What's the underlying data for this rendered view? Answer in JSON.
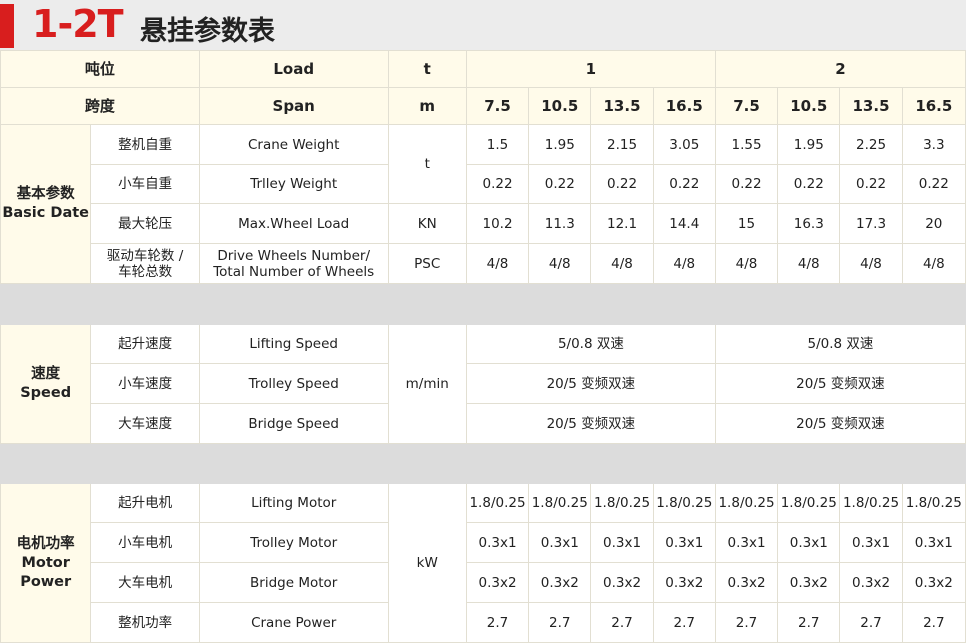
{
  "title": {
    "num": "1-2T",
    "text": "悬挂参数表"
  },
  "header": {
    "row1": {
      "cn": "吨位",
      "en": "Load",
      "unit": "t",
      "cap1": "1",
      "cap2": "2"
    },
    "row2": {
      "cn": "跨度",
      "en": "Span",
      "unit": "m",
      "spans": [
        "7.5",
        "10.5",
        "13.5",
        "16.5",
        "7.5",
        "10.5",
        "13.5",
        "16.5"
      ]
    }
  },
  "groups": {
    "basic": {
      "cn": "基本参数",
      "en": "Basic Date"
    },
    "speed": {
      "cn": "速度",
      "en": "Speed"
    },
    "motor": {
      "cn": "电机功率",
      "en1": "Motor",
      "en2": "Power"
    }
  },
  "units": {
    "weight": "t",
    "wheel_load": "KN",
    "wheels": "PSC",
    "speed": "m/min",
    "power": "kW"
  },
  "rows": {
    "crane_weight": {
      "cn": "整机自重",
      "en": "Crane Weight",
      "values": [
        "1.5",
        "1.95",
        "2.15",
        "3.05",
        "1.55",
        "1.95",
        "2.25",
        "3.3"
      ]
    },
    "trolley_weight": {
      "cn": "小车自重",
      "en": "Trlley Weight",
      "values": [
        "0.22",
        "0.22",
        "0.22",
        "0.22",
        "0.22",
        "0.22",
        "0.22",
        "0.22"
      ]
    },
    "wheel_load": {
      "cn": "最大轮压",
      "en": "Max.Wheel Load",
      "values": [
        "10.2",
        "11.3",
        "12.1",
        "14.4",
        "15",
        "16.3",
        "17.3",
        "20"
      ]
    },
    "wheels": {
      "cn1": "驱动车轮数 /",
      "cn2": "车轮总数",
      "en1": "Drive Wheels Number/",
      "en2": "Total Number of Wheels",
      "values": [
        "4/8",
        "4/8",
        "4/8",
        "4/8",
        "4/8",
        "4/8",
        "4/8",
        "4/8"
      ]
    },
    "lifting_speed": {
      "cn": "起升速度",
      "en": "Lifting Speed",
      "v1": "5/0.8 双速",
      "v2": "5/0.8 双速"
    },
    "trolley_speed": {
      "cn": "小车速度",
      "en": "Trolley Speed",
      "v1": "20/5 变频双速",
      "v2": "20/5 变频双速"
    },
    "bridge_speed": {
      "cn": "大车速度",
      "en": "Bridge Speed",
      "v1": "20/5 变频双速",
      "v2": "20/5 变频双速"
    },
    "lifting_motor": {
      "cn": "起升电机",
      "en": "Lifting Motor",
      "values": [
        "1.8/0.25",
        "1.8/0.25",
        "1.8/0.25",
        "1.8/0.25",
        "1.8/0.25",
        "1.8/0.25",
        "1.8/0.25",
        "1.8/0.25"
      ]
    },
    "trolley_motor": {
      "cn": "小车电机",
      "en": "Trolley Motor",
      "values": [
        "0.3x1",
        "0.3x1",
        "0.3x1",
        "0.3x1",
        "0.3x1",
        "0.3x1",
        "0.3x1",
        "0.3x1"
      ]
    },
    "bridge_motor": {
      "cn": "大车电机",
      "en": "Bridge Motor",
      "values": [
        "0.3x2",
        "0.3x2",
        "0.3x2",
        "0.3x2",
        "0.3x2",
        "0.3x2",
        "0.3x2",
        "0.3x2"
      ]
    },
    "crane_power": {
      "cn": "整机功率",
      "en": "Crane Power",
      "values": [
        "2.7",
        "2.7",
        "2.7",
        "2.7",
        "2.7",
        "2.7",
        "2.7",
        "2.7"
      ]
    }
  }
}
